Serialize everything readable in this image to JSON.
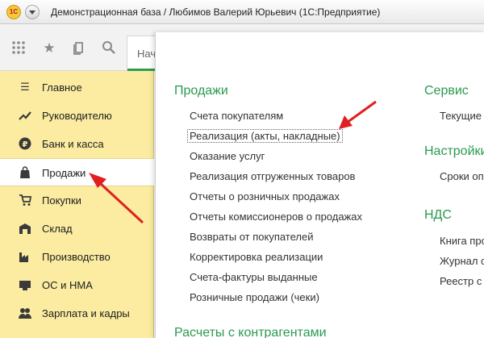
{
  "window": {
    "title": "Демонстрационная база / Любимов Валерий Юрьевич  (1С:Предприятие)",
    "logo_text": "1С"
  },
  "toolbar": {
    "tab_start_label": "Нач"
  },
  "sidebar": {
    "items": [
      {
        "label": "Главное",
        "icon": "menu-icon"
      },
      {
        "label": "Руководителю",
        "icon": "trend-icon"
      },
      {
        "label": "Банк и касса",
        "icon": "ruble-icon"
      },
      {
        "label": "Продажи",
        "icon": "shopping-bag-icon",
        "active": true
      },
      {
        "label": "Покупки",
        "icon": "cart-icon"
      },
      {
        "label": "Склад",
        "icon": "warehouse-icon"
      },
      {
        "label": "Производство",
        "icon": "factory-icon"
      },
      {
        "label": "ОС и НМА",
        "icon": "assets-icon"
      },
      {
        "label": "Зарплата и кадры",
        "icon": "people-icon"
      }
    ]
  },
  "panel": {
    "sales": {
      "heading": "Продажи",
      "links": [
        "Счета покупателям",
        "Реализация (акты, накладные)",
        "Оказание услуг",
        "Реализация отгруженных товаров",
        "Отчеты о розничных продажах",
        "Отчеты комиссионеров о продажах",
        "Возвраты от покупателей",
        "Корректировка реализации",
        "Счета-фактуры выданные",
        "Розничные продажи (чеки)"
      ]
    },
    "settlements": {
      "heading": "Расчеты с контрагентами"
    },
    "service": {
      "heading": "Сервис",
      "links": [
        "Текущие"
      ]
    },
    "settings": {
      "heading": "Настройки",
      "links": [
        "Сроки оп"
      ]
    },
    "vat": {
      "heading": "НДС",
      "links": [
        "Книга про",
        "Журнал с",
        "Реестр с"
      ]
    }
  },
  "colors": {
    "sidebar_bg": "#fbeca1",
    "section_heading": "#2a9a4f",
    "arrow": "#e02020"
  }
}
